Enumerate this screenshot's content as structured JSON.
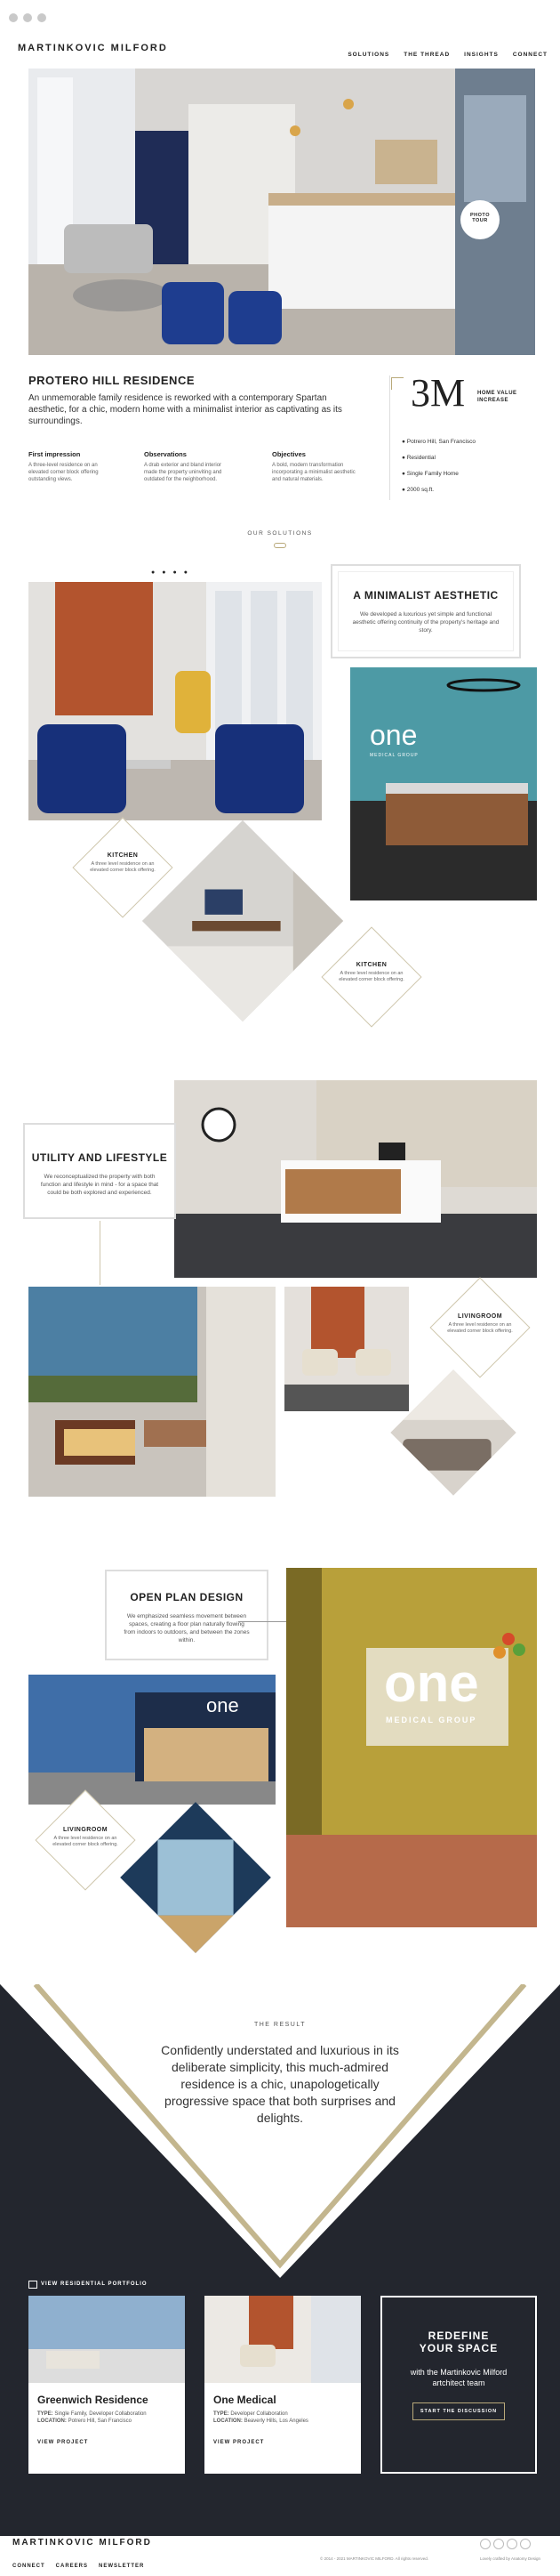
{
  "window": {
    "dots": [
      "close",
      "minimize",
      "maximize"
    ]
  },
  "header": {
    "logo": "MARTINKOVIC MILFORD",
    "nav": [
      "SOLUTIONS",
      "THE THREAD",
      "INSIGHTS",
      "CONNECT"
    ]
  },
  "hero": {
    "badge_line1": "PHOTO",
    "badge_line2": "TOUR"
  },
  "project": {
    "title": "PROTERO HILL RESIDENCE",
    "intro": "An unmemorable family residence is reworked with a contemporary Spartan aesthetic, for a chic, modern home with a minimalist interior as captivating as its surroundings.",
    "columns": [
      {
        "heading": "First impression",
        "text": "A three-level residence on an elevated corner block offering outstanding views."
      },
      {
        "heading": "Observations",
        "text": "A drab exterior and bland interior made the property uninviting and outdated for the neighborhood."
      },
      {
        "heading": "Objectives",
        "text": "A bold, modern transformation incorporating a minimalist aesthetic and natural materials."
      }
    ],
    "stat": {
      "value": "3M",
      "label_line1": "HOME VALUE",
      "label_line2": "INCREASE"
    },
    "facts": [
      "Potrero Hill, San Francisco",
      "Residential",
      "Single Family Home",
      "2000 sq.ft."
    ]
  },
  "solutions": {
    "label": "OUR SOLUTIONS",
    "pager": [
      "1",
      "2",
      "3",
      "4"
    ]
  },
  "aesthetic": {
    "title": "A MINIMALIST AESTHETIC",
    "text": "We developed a luxurious yet simple and functional aesthetic offering continuity of the property's heritage and story."
  },
  "diamonds": [
    {
      "title": "KITCHEN",
      "text": "A three level residence on an elevated corner block offering."
    },
    {
      "title": "KITCHEN",
      "text": "A three level residence on an elevated corner block offering."
    },
    {
      "title": "LIVINGROOM",
      "text": "A three level residence on an elevated corner block offering."
    },
    {
      "title": "LIVINGROOM",
      "text": "A three level residence on an elevated corner block offering."
    }
  ],
  "utility": {
    "title": "UTILITY AND LIFESTYLE",
    "text": "We reconceptualized the property with both function and lifestyle in mind - for a space that could be both explored and experienced."
  },
  "openplan": {
    "title": "OPEN PLAN DESIGN",
    "text": "We emphasized seamless movement between spaces, creating a floor plan naturally flowing from indoors to outdoors, and between the zones within."
  },
  "result": {
    "label": "THE RESULT",
    "quote": "Confidently understated and luxurious in its deliberate simplicity, this much-admired residence is a chic, unapologetically progressive space that both surprises and delights."
  },
  "portfolio": {
    "label": "VIEW RESIDENTIAL PORTFOLIO",
    "cards": [
      {
        "title": "Greenwich Residence",
        "type_label": "TYPE:",
        "type": "Single Family, Developer Collaboration",
        "loc_label": "LOCATION:",
        "location": "Potrero Hill, San Francisco",
        "cta": "VIEW PROJECT"
      },
      {
        "title": "One Medical",
        "type_label": "TYPE:",
        "type": "Developer Collaboration",
        "loc_label": "LOCATION:",
        "location": "Beaverly Hills, Los Angeles",
        "cta": "VIEW PROJECT"
      }
    ],
    "promo": {
      "title_line1": "REDEFINE",
      "title_line2": "YOUR SPACE",
      "sub": "with the Martinkovic Milford artchitect team",
      "cta": "START THE DISCUSSION"
    }
  },
  "footer": {
    "logo": "MARTINKOVIC MILFORD",
    "links": [
      "CONNECT",
      "CAREERS",
      "NEWSLETTER"
    ],
    "copyright": "© 2014 - 2021 MARTINKOVIC MILFORD. All rights reserved.",
    "credit": "Lovely crafted by Anatomy Design"
  },
  "signage": {
    "brand": "one",
    "sub": "MEDICAL GROUP",
    "sign_brand": "one",
    "sign_sub": "MEDICAL GROUP"
  },
  "colors": {
    "accent": "#b9a97a",
    "dark": "#23262e"
  }
}
